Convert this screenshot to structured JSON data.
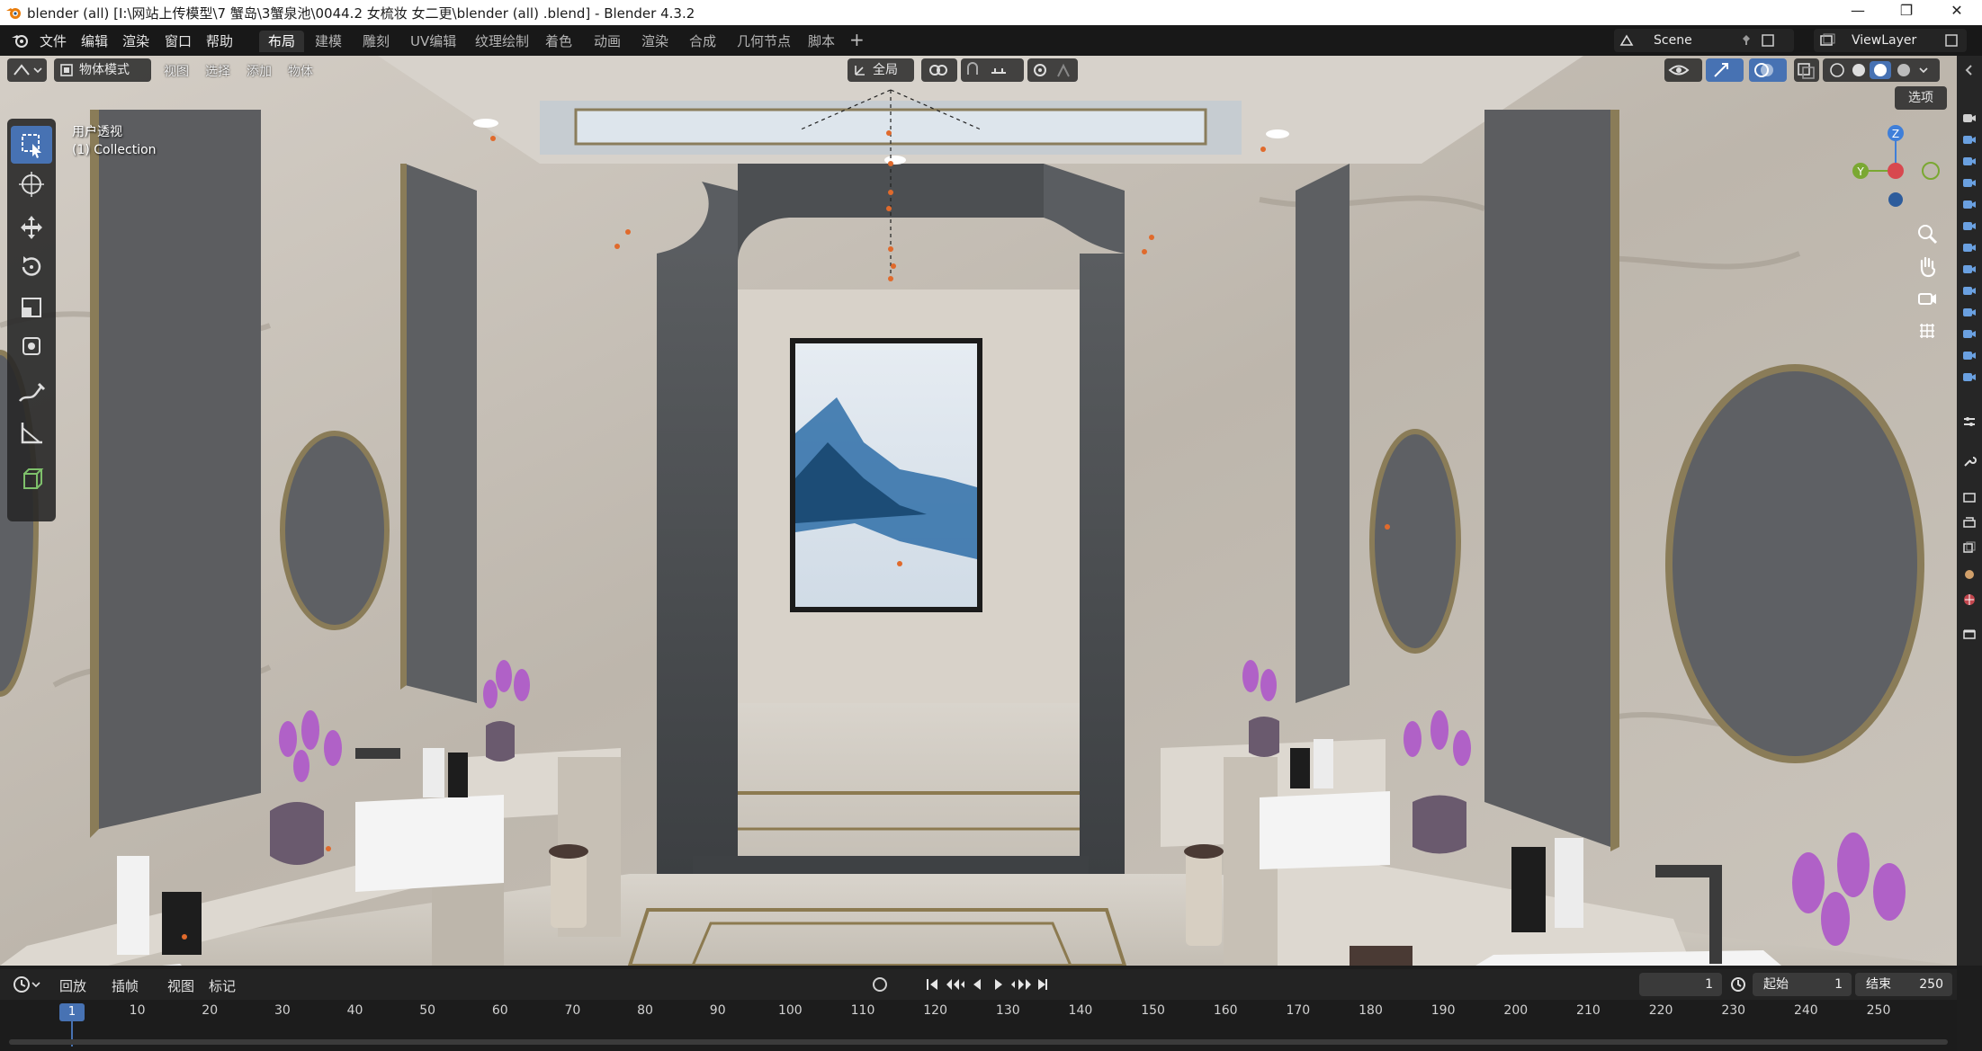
{
  "window": {
    "title": "blender (all)   [I:\\网站上传模型\\7 蟹岛\\3蟹泉池\\0044.2 女梳妆 女二更\\blender (all)  .blend] - Blender 4.3.2",
    "minimize": "—",
    "maximize": "❐",
    "close": "✕"
  },
  "menu": [
    "文件",
    "编辑",
    "渲染",
    "窗口",
    "帮助"
  ],
  "workspaces": [
    "布局",
    "建模",
    "雕刻",
    "UV编辑",
    "纹理绘制",
    "着色",
    "动画",
    "渲染",
    "合成",
    "几何节点",
    "脚本"
  ],
  "active_workspace": "布局",
  "add_workspace": "+",
  "scene_name": "Scene",
  "view_layer": "ViewLayer",
  "viewport_header": {
    "mode": "物体模式",
    "menus": [
      "视图",
      "选择",
      "添加",
      "物体"
    ],
    "transform_orientation": "全局",
    "options_label": "选项"
  },
  "viewport_overlay": {
    "view_name": "用户透视",
    "collection": "(1) Collection"
  },
  "gizmo": {
    "x": "X",
    "y": "Y",
    "z": "Z"
  },
  "colors": {
    "accent": "#4772b3",
    "axis_x": "#d8484f",
    "axis_y": "#7aa832",
    "axis_z": "#3f7fd9",
    "origin_dot": "#e06a2c"
  },
  "timeline": {
    "menus": [
      "回放",
      "插帧",
      "视图",
      "标记"
    ],
    "current_frame": "1",
    "start_label": "起始",
    "start_value": "1",
    "end_label": "结束",
    "end_value": "250",
    "ticks": [
      "1",
      "10",
      "20",
      "30",
      "40",
      "50",
      "60",
      "70",
      "80",
      "90",
      "100",
      "110",
      "120",
      "130",
      "140",
      "150",
      "160",
      "170",
      "180",
      "190",
      "200",
      "210",
      "220",
      "230",
      "240",
      "250"
    ]
  },
  "icons": {
    "tools": [
      "select-box-icon",
      "cursor-icon",
      "move-icon",
      "rotate-icon",
      "scale-icon",
      "transform-icon",
      "annotate-icon",
      "measure-icon",
      "add-cube-icon"
    ],
    "nav": [
      "zoom-icon",
      "pan-hand-icon",
      "camera-view-icon",
      "ortho-grid-icon"
    ]
  }
}
